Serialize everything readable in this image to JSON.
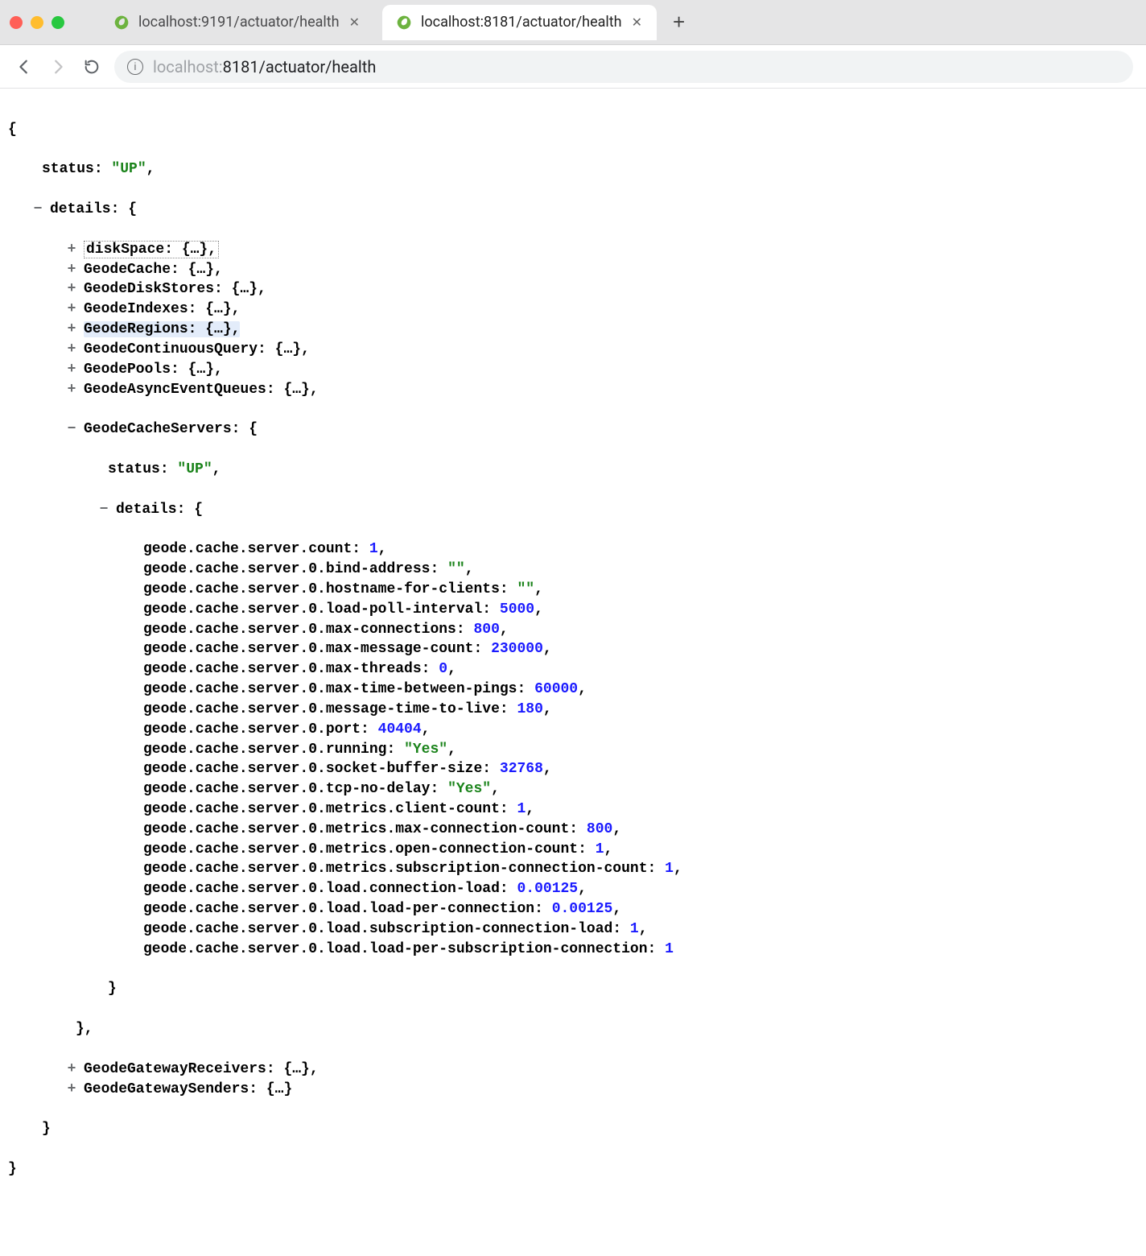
{
  "browser": {
    "tabs": [
      {
        "title": "localhost:9191/actuator/health",
        "active": false
      },
      {
        "title": "localhost:8181/actuator/health",
        "active": true
      }
    ],
    "url_scheme": "localhost:",
    "url_rest": "8181/actuator/health"
  },
  "json": {
    "status": "\"UP\"",
    "details_label": "details",
    "collapsed": [
      {
        "key": "diskSpace",
        "dotted": true
      },
      {
        "key": "GeodeCache"
      },
      {
        "key": "GeodeDiskStores"
      },
      {
        "key": "GeodeIndexes"
      },
      {
        "key": "GeodeRegions",
        "highlight": true
      },
      {
        "key": "GeodeContinuousQuery"
      },
      {
        "key": "GeodePools"
      },
      {
        "key": "GeodeAsyncEventQueues"
      }
    ],
    "cacheServers": {
      "key": "GeodeCacheServers",
      "status": "\"UP\"",
      "details_label": "details",
      "rows": [
        {
          "k": "geode.cache.server.count",
          "v": "1",
          "t": "num"
        },
        {
          "k": "geode.cache.server.0.bind-address",
          "v": "\"\"",
          "t": "str"
        },
        {
          "k": "geode.cache.server.0.hostname-for-clients",
          "v": "\"\"",
          "t": "str"
        },
        {
          "k": "geode.cache.server.0.load-poll-interval",
          "v": "5000",
          "t": "num"
        },
        {
          "k": "geode.cache.server.0.max-connections",
          "v": "800",
          "t": "num"
        },
        {
          "k": "geode.cache.server.0.max-message-count",
          "v": "230000",
          "t": "num"
        },
        {
          "k": "geode.cache.server.0.max-threads",
          "v": "0",
          "t": "num"
        },
        {
          "k": "geode.cache.server.0.max-time-between-pings",
          "v": "60000",
          "t": "num"
        },
        {
          "k": "geode.cache.server.0.message-time-to-live",
          "v": "180",
          "t": "num"
        },
        {
          "k": "geode.cache.server.0.port",
          "v": "40404",
          "t": "num"
        },
        {
          "k": "geode.cache.server.0.running",
          "v": "\"Yes\"",
          "t": "str"
        },
        {
          "k": "geode.cache.server.0.socket-buffer-size",
          "v": "32768",
          "t": "num"
        },
        {
          "k": "geode.cache.server.0.tcp-no-delay",
          "v": "\"Yes\"",
          "t": "str"
        },
        {
          "k": "geode.cache.server.0.metrics.client-count",
          "v": "1",
          "t": "num"
        },
        {
          "k": "geode.cache.server.0.metrics.max-connection-count",
          "v": "800",
          "t": "num"
        },
        {
          "k": "geode.cache.server.0.metrics.open-connection-count",
          "v": "1",
          "t": "num"
        },
        {
          "k": "geode.cache.server.0.metrics.subscription-connection-count",
          "v": "1",
          "t": "num"
        },
        {
          "k": "geode.cache.server.0.load.connection-load",
          "v": "0.00125",
          "t": "num"
        },
        {
          "k": "geode.cache.server.0.load.load-per-connection",
          "v": "0.00125",
          "t": "num"
        },
        {
          "k": "geode.cache.server.0.load.subscription-connection-load",
          "v": "1",
          "t": "num"
        },
        {
          "k": "geode.cache.server.0.load.load-per-subscription-connection",
          "v": "1",
          "t": "num",
          "last": true
        }
      ]
    },
    "tail_collapsed": [
      {
        "key": "GeodeGatewayReceivers",
        "comma": true
      },
      {
        "key": "GeodeGatewaySenders",
        "comma": false
      }
    ]
  }
}
